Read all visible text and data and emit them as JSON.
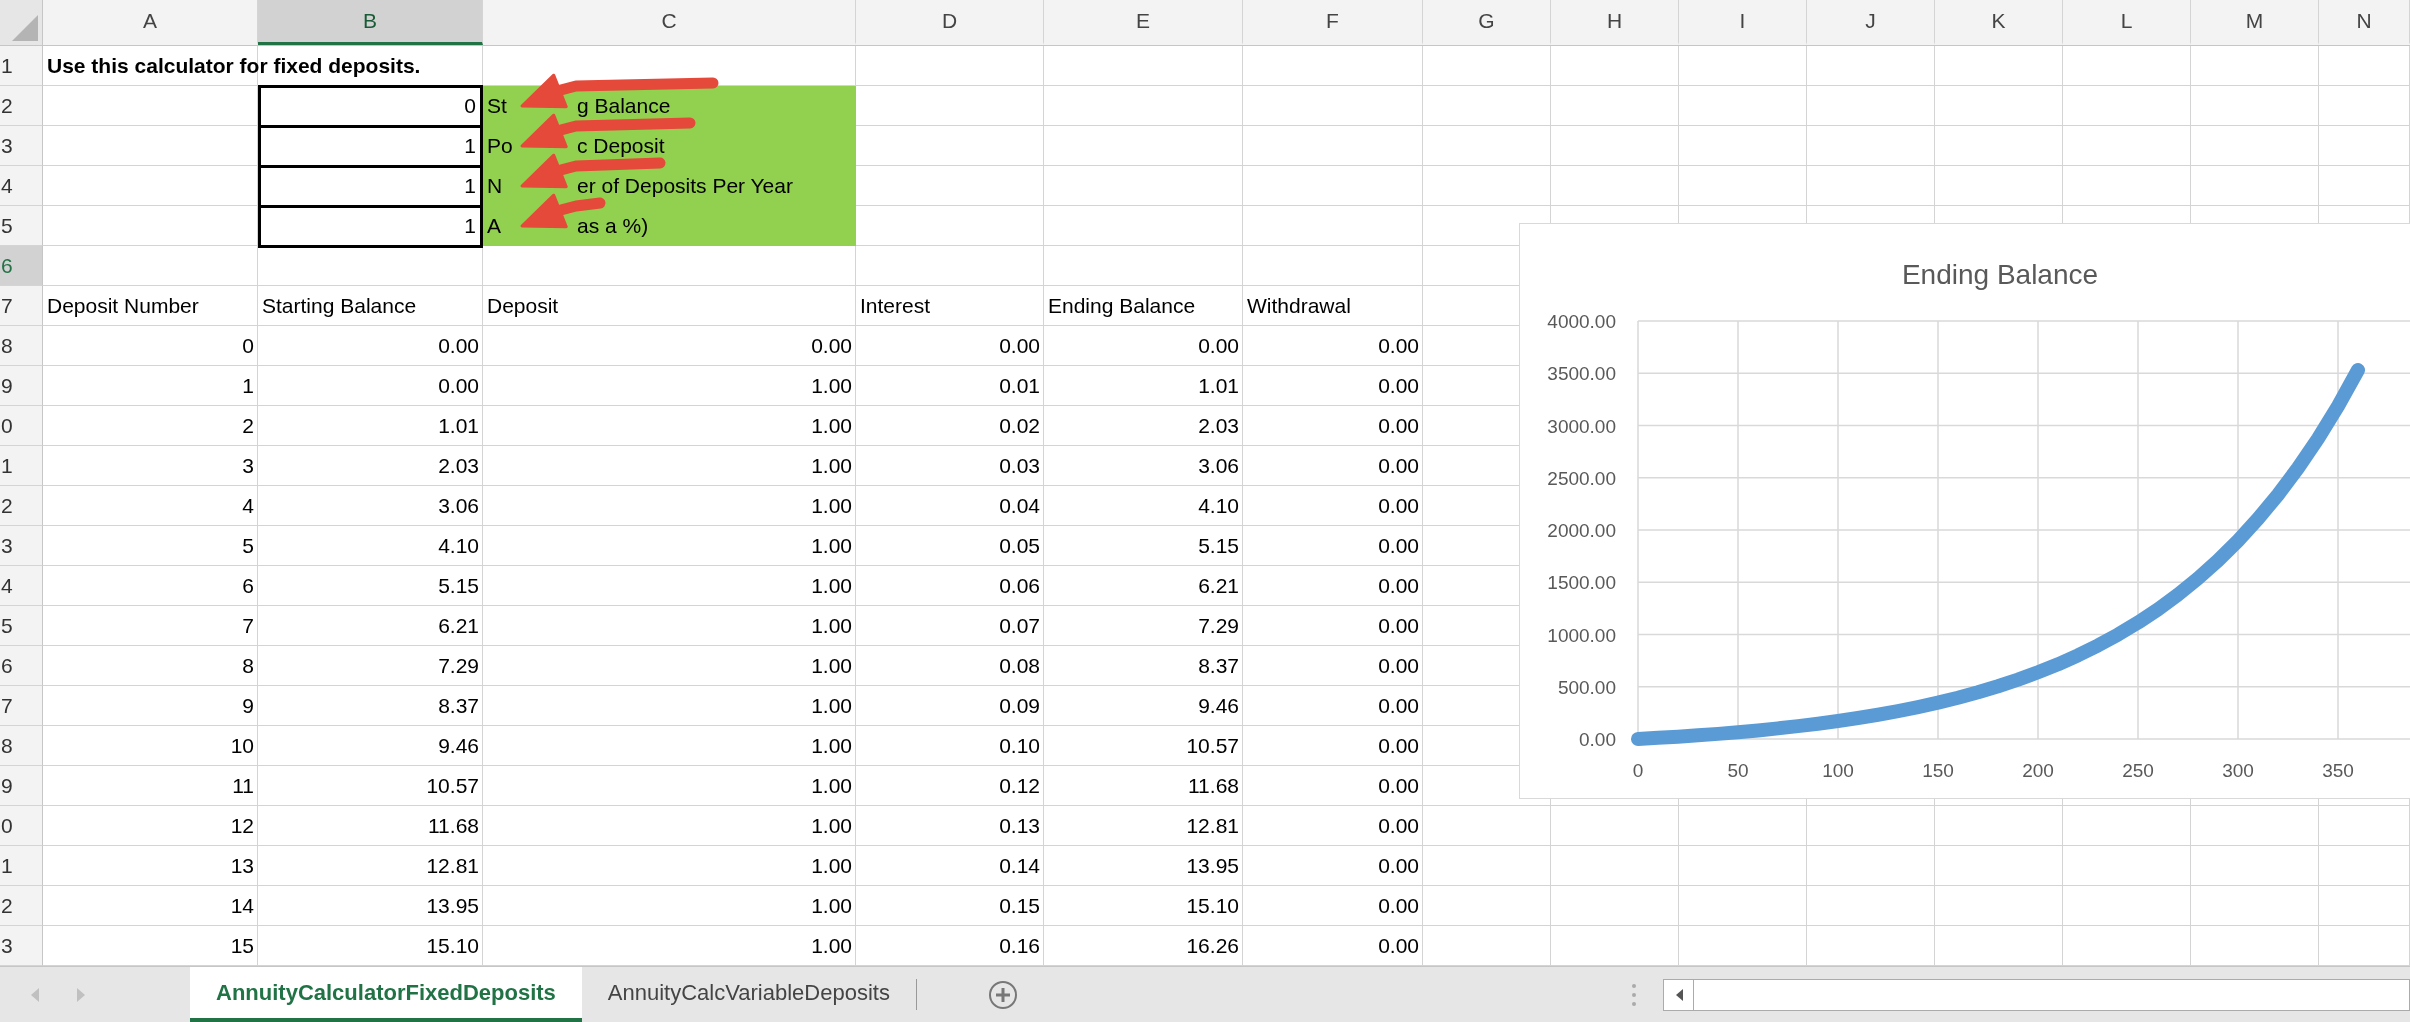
{
  "column_headers": [
    {
      "label": "A",
      "selected": false
    },
    {
      "label": "B",
      "selected": true
    },
    {
      "label": "C",
      "selected": false
    },
    {
      "label": "D",
      "selected": false
    },
    {
      "label": "E",
      "selected": false
    },
    {
      "label": "F",
      "selected": false
    },
    {
      "label": "G",
      "selected": false
    },
    {
      "label": "H",
      "selected": false
    },
    {
      "label": "I",
      "selected": false
    },
    {
      "label": "J",
      "selected": false
    },
    {
      "label": "K",
      "selected": false
    },
    {
      "label": "L",
      "selected": false
    },
    {
      "label": "M",
      "selected": false
    },
    {
      "label": "N",
      "selected": false
    }
  ],
  "rows": [
    {
      "number": "1",
      "selected": false,
      "kind": "title",
      "text": "Use this calculator for fixed deposits."
    },
    {
      "number": "2",
      "selected": false,
      "kind": "input",
      "value": "0",
      "label_parts": [
        "St",
        "g Balance"
      ],
      "arrow": true
    },
    {
      "number": "3",
      "selected": false,
      "kind": "input",
      "value": "1",
      "label_parts": [
        "Po",
        "c Deposit"
      ],
      "arrow": true
    },
    {
      "number": "4",
      "selected": false,
      "kind": "input",
      "value": "1",
      "label_parts": [
        "N",
        "er of Deposits Per Year"
      ],
      "arrow": true
    },
    {
      "number": "5",
      "selected": false,
      "kind": "input",
      "value": "1",
      "label_parts": [
        "A",
        "as a %)"
      ],
      "arrow": true
    },
    {
      "number": "6",
      "selected": true,
      "kind": "blank"
    },
    {
      "number": "7",
      "selected": false,
      "kind": "header",
      "cells": [
        "Deposit Number",
        "Starting Balance",
        "Deposit",
        "Interest",
        "Ending Balance",
        "Withdrawal"
      ]
    },
    {
      "number": "8",
      "selected": false,
      "kind": "data",
      "cells": [
        "0",
        "0.00",
        "0.00",
        "0.00",
        "0.00",
        "0.00"
      ]
    },
    {
      "number": "9",
      "selected": false,
      "kind": "data",
      "cells": [
        "1",
        "0.00",
        "1.00",
        "0.01",
        "1.01",
        "0.00"
      ]
    },
    {
      "number": "0",
      "selected": false,
      "kind": "data",
      "cells": [
        "2",
        "1.01",
        "1.00",
        "0.02",
        "2.03",
        "0.00"
      ]
    },
    {
      "number": "1",
      "selected": false,
      "kind": "data",
      "cells": [
        "3",
        "2.03",
        "1.00",
        "0.03",
        "3.06",
        "0.00"
      ]
    },
    {
      "number": "2",
      "selected": false,
      "kind": "data",
      "cells": [
        "4",
        "3.06",
        "1.00",
        "0.04",
        "4.10",
        "0.00"
      ]
    },
    {
      "number": "3",
      "selected": false,
      "kind": "data",
      "cells": [
        "5",
        "4.10",
        "1.00",
        "0.05",
        "5.15",
        "0.00"
      ]
    },
    {
      "number": "4",
      "selected": false,
      "kind": "data",
      "cells": [
        "6",
        "5.15",
        "1.00",
        "0.06",
        "6.21",
        "0.00"
      ]
    },
    {
      "number": "5",
      "selected": false,
      "kind": "data",
      "cells": [
        "7",
        "6.21",
        "1.00",
        "0.07",
        "7.29",
        "0.00"
      ]
    },
    {
      "number": "6",
      "selected": false,
      "kind": "data",
      "cells": [
        "8",
        "7.29",
        "1.00",
        "0.08",
        "8.37",
        "0.00"
      ]
    },
    {
      "number": "7",
      "selected": false,
      "kind": "data",
      "cells": [
        "9",
        "8.37",
        "1.00",
        "0.09",
        "9.46",
        "0.00"
      ]
    },
    {
      "number": "8",
      "selected": false,
      "kind": "data",
      "cells": [
        "10",
        "9.46",
        "1.00",
        "0.10",
        "10.57",
        "0.00"
      ]
    },
    {
      "number": "9",
      "selected": false,
      "kind": "data",
      "cells": [
        "11",
        "10.57",
        "1.00",
        "0.12",
        "11.68",
        "0.00"
      ]
    },
    {
      "number": "0",
      "selected": false,
      "kind": "data",
      "cells": [
        "12",
        "11.68",
        "1.00",
        "0.13",
        "12.81",
        "0.00"
      ]
    },
    {
      "number": "1",
      "selected": false,
      "kind": "data",
      "cells": [
        "13",
        "12.81",
        "1.00",
        "0.14",
        "13.95",
        "0.00"
      ]
    },
    {
      "number": "2",
      "selected": false,
      "kind": "data",
      "cells": [
        "14",
        "13.95",
        "1.00",
        "0.15",
        "15.10",
        "0.00"
      ]
    },
    {
      "number": "3",
      "selected": false,
      "kind": "data",
      "cells": [
        "15",
        "15.10",
        "1.00",
        "0.16",
        "16.26",
        "0.00"
      ]
    }
  ],
  "chart": {
    "chart_data": {
      "type": "line",
      "title": "Ending Balance",
      "grid": true,
      "xlim": [
        0,
        386
      ],
      "ylim": [
        0,
        4000
      ],
      "xticks": [
        0,
        50,
        100,
        150,
        200,
        250,
        300,
        350
      ],
      "yticks": [
        {
          "value": 0,
          "label": "0.00"
        },
        {
          "value": 500,
          "label": "500.00"
        },
        {
          "value": 1000,
          "label": "1000.00"
        },
        {
          "value": 1500,
          "label": "1500.00"
        },
        {
          "value": 2000,
          "label": "2000.00"
        },
        {
          "value": 2500,
          "label": "2500.00"
        },
        {
          "value": 3000,
          "label": "3000.00"
        },
        {
          "value": 3500,
          "label": "3500.00"
        },
        {
          "value": 4000,
          "label": "4000.00"
        }
      ],
      "x": [
        0,
        10,
        20,
        30,
        40,
        50,
        60,
        70,
        80,
        90,
        100,
        110,
        120,
        130,
        140,
        150,
        160,
        170,
        180,
        190,
        200,
        210,
        220,
        230,
        240,
        250,
        260,
        270,
        280,
        290,
        300,
        310,
        320,
        330,
        340,
        350,
        360
      ],
      "series": [
        {
          "color": "#5b9bd5",
          "values": [
            0,
            11,
            22,
            35,
            49,
            65,
            82,
            102,
            123,
            146,
            172,
            201,
            232,
            267,
            306,
            348,
            395,
            447,
            505,
            568,
            639,
            715,
            801,
            895,
            999,
            1114,
            1241,
            1382,
            1537,
            1708,
            1898,
            2107,
            2338,
            2593,
            2875,
            3186,
            3531
          ]
        }
      ]
    }
  },
  "sheet_tabs": [
    {
      "label": "AnnuityCalculatorFixedDeposits",
      "selected": true
    },
    {
      "label": "AnnuityCalcVariableDeposits",
      "selected": false
    }
  ]
}
